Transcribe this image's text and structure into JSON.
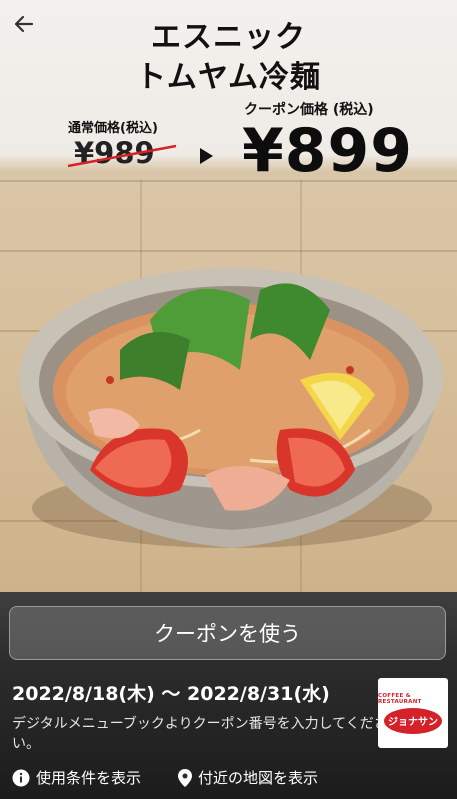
{
  "header": {
    "title_line1": "エスニック",
    "title_line2": "トムヤム冷麺",
    "regular_price_label": "通常価格(税込)",
    "regular_price": "¥989",
    "coupon_price_label": "クーポン価格 (税込)",
    "coupon_price": "¥899"
  },
  "actions": {
    "use_coupon": "クーポンを使う",
    "terms": "使用条件を表示",
    "map": "付近の地図を表示"
  },
  "coupon": {
    "period": "2022/8/18(木) 〜 2022/8/31(水)",
    "note": "デジタルメニューブックよりクーポン番号を入力してください。"
  },
  "logo": {
    "top_text": "COFFEE & RESTAURANT",
    "brand": "ジョナサン"
  },
  "colors": {
    "button_bg": "#7a7a7a",
    "brand_red": "#d4212a"
  },
  "icons": {
    "back": "arrow-left-icon",
    "info": "info-icon",
    "pin": "map-pin-icon"
  }
}
